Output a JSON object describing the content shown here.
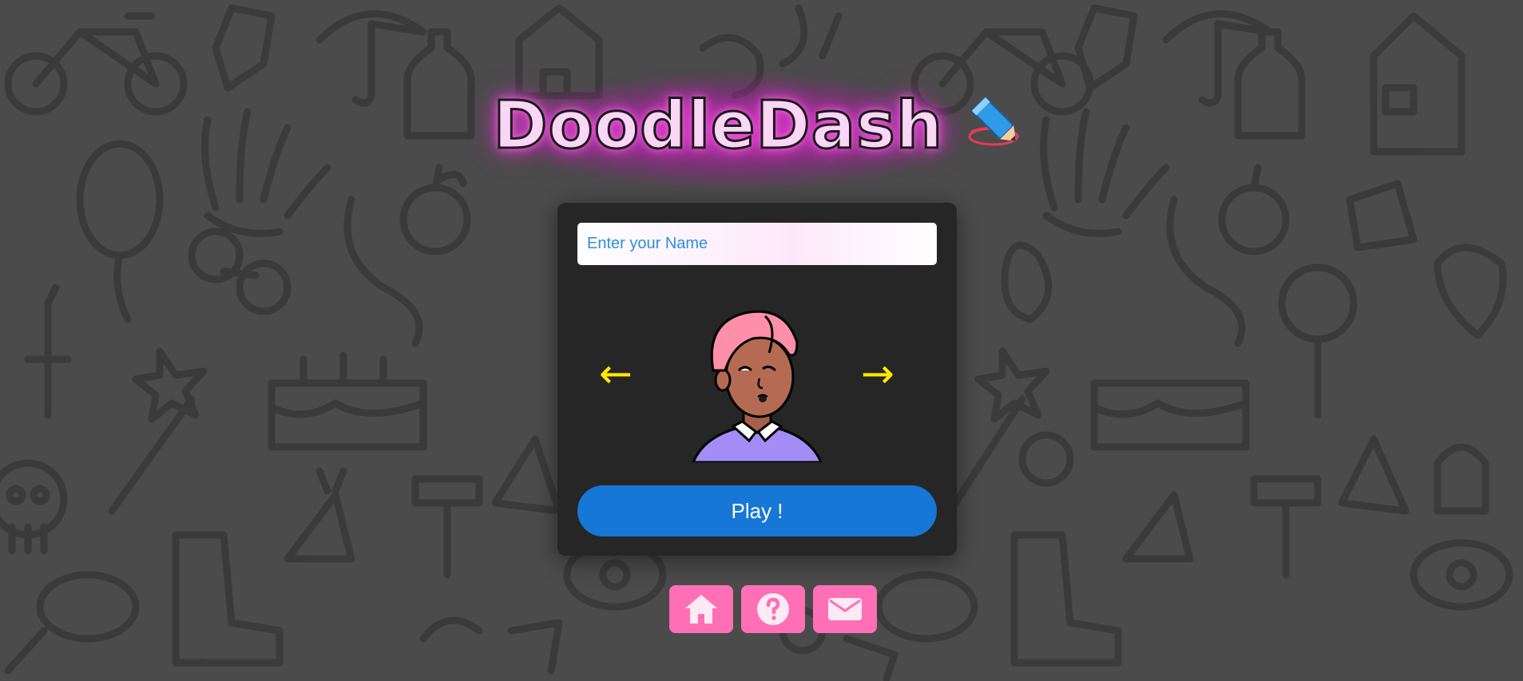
{
  "app": {
    "logo_text": "DoodleDash",
    "logo_icon": "pencil-scribble-icon"
  },
  "form": {
    "name_placeholder": "Enter your Name",
    "name_value": ""
  },
  "avatar_selector": {
    "prev_label": "←",
    "next_label": "→",
    "avatar_icon": "avatar-pink-turban-icon"
  },
  "play_button": {
    "label": "Play !"
  },
  "footer": {
    "buttons": [
      {
        "icon": "home-icon"
      },
      {
        "icon": "help-icon"
      },
      {
        "icon": "mail-icon"
      }
    ]
  },
  "colors": {
    "background": "#4a4a4a",
    "card": "#262626",
    "accent_blue": "#1677d6",
    "accent_pink": "#ff6fb5",
    "arrow_yellow": "#ffea00",
    "logo_glow": "#e23fd0"
  }
}
